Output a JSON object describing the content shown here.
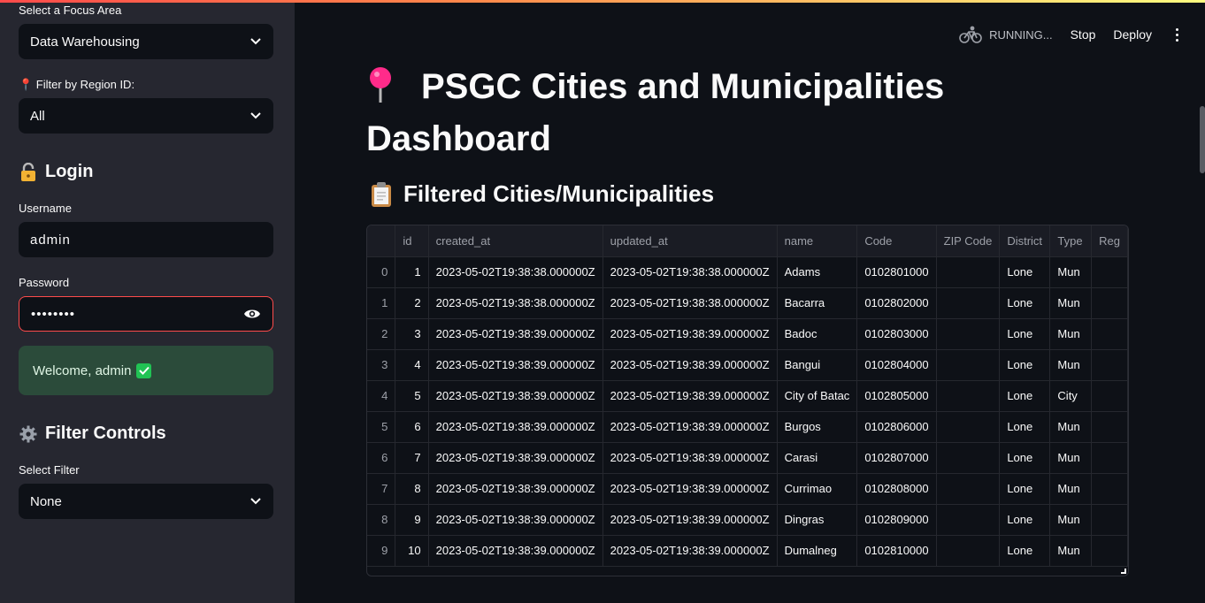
{
  "sidebar": {
    "focus_label": "Select a Focus Area",
    "focus_value": "Data Warehousing",
    "region_label": "📍 Filter by Region ID:",
    "region_value": "All",
    "login_heading": "Login",
    "username_label": "Username",
    "username_value": "admin",
    "password_label": "Password",
    "password_value": "••••••••",
    "welcome_text": "Welcome, admin",
    "filter_heading": "Filter Controls",
    "select_filter_label": "Select Filter",
    "select_filter_value": "None"
  },
  "toolbar": {
    "running": "RUNNING...",
    "stop": "Stop",
    "deploy": "Deploy"
  },
  "main": {
    "title": "PSGC Cities and Municipalities Dashboard",
    "subtitle": "Filtered Cities/Municipalities"
  },
  "table": {
    "columns": [
      "",
      "id",
      "created_at",
      "updated_at",
      "name",
      "Code",
      "ZIP Code",
      "District",
      "Type",
      "Reg"
    ],
    "rows": [
      [
        "0",
        "1",
        "2023-05-02T19:38:38.000000Z",
        "2023-05-02T19:38:38.000000Z",
        "Adams",
        "0102801000",
        "",
        "Lone",
        "Mun",
        ""
      ],
      [
        "1",
        "2",
        "2023-05-02T19:38:38.000000Z",
        "2023-05-02T19:38:38.000000Z",
        "Bacarra",
        "0102802000",
        "",
        "Lone",
        "Mun",
        ""
      ],
      [
        "2",
        "3",
        "2023-05-02T19:38:39.000000Z",
        "2023-05-02T19:38:39.000000Z",
        "Badoc",
        "0102803000",
        "",
        "Lone",
        "Mun",
        ""
      ],
      [
        "3",
        "4",
        "2023-05-02T19:38:39.000000Z",
        "2023-05-02T19:38:39.000000Z",
        "Bangui",
        "0102804000",
        "",
        "Lone",
        "Mun",
        ""
      ],
      [
        "4",
        "5",
        "2023-05-02T19:38:39.000000Z",
        "2023-05-02T19:38:39.000000Z",
        "City of Batac",
        "0102805000",
        "",
        "Lone",
        "City",
        ""
      ],
      [
        "5",
        "6",
        "2023-05-02T19:38:39.000000Z",
        "2023-05-02T19:38:39.000000Z",
        "Burgos",
        "0102806000",
        "",
        "Lone",
        "Mun",
        ""
      ],
      [
        "6",
        "7",
        "2023-05-02T19:38:39.000000Z",
        "2023-05-02T19:38:39.000000Z",
        "Carasi",
        "0102807000",
        "",
        "Lone",
        "Mun",
        ""
      ],
      [
        "7",
        "8",
        "2023-05-02T19:38:39.000000Z",
        "2023-05-02T19:38:39.000000Z",
        "Currimao",
        "0102808000",
        "",
        "Lone",
        "Mun",
        ""
      ],
      [
        "8",
        "9",
        "2023-05-02T19:38:39.000000Z",
        "2023-05-02T19:38:39.000000Z",
        "Dingras",
        "0102809000",
        "",
        "Lone",
        "Mun",
        ""
      ],
      [
        "9",
        "10",
        "2023-05-02T19:38:39.000000Z",
        "2023-05-02T19:38:39.000000Z",
        "Dumalneg",
        "0102810000",
        "",
        "Lone",
        "Mun",
        ""
      ]
    ]
  },
  "colors": {
    "background": "#0e1117",
    "sidebar": "#262730",
    "accent": "#ff4b4b",
    "success_bg": "#2b4b3a",
    "pin": "#ff2b8a"
  },
  "icons": [
    "chevron-down-icon",
    "pin-icon",
    "lock-icon",
    "eye-icon",
    "checkmark-icon",
    "gear-icon",
    "clipboard-icon",
    "bicycle-icon",
    "more-vertical-icon"
  ]
}
